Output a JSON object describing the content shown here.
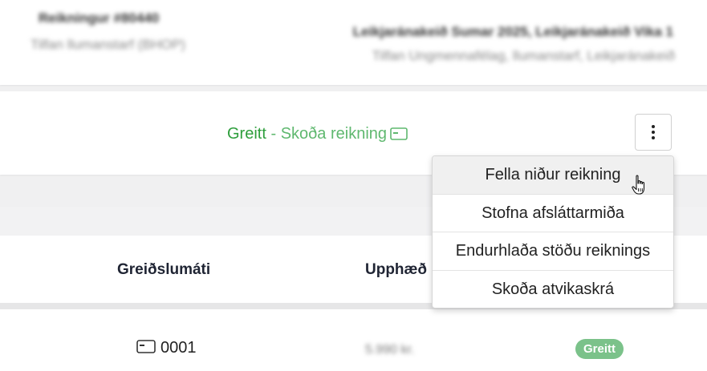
{
  "invoice": {
    "number": "Reikningur #80440",
    "subtitle": "Tilfan llumanstarf (BHOP)"
  },
  "event": {
    "title": "Leikjaránakeið Sumar 2025, Leikjaránakeið Vika 1",
    "subtitle": "Tilfan Ungmennafélag, llumanstarf, Leikjaránakeið"
  },
  "status": {
    "paid_label": "Greitt",
    "separator": "-",
    "view_invoice_label": "Skoða reikning",
    "paid_color": "#2e9e3c",
    "link_color": "#5fb86f"
  },
  "actions_menu": {
    "items": [
      "Fella niður reikning",
      "Stofna afsláttarmiða",
      "Endurhlaða stöðu reiknings",
      "Skoða atvikaskrá"
    ],
    "hovered_index": 0
  },
  "table": {
    "headers": [
      "Greiðslumáti",
      "Upphæð"
    ],
    "rows": [
      {
        "method": "0001",
        "amount": "5.990 kr.",
        "status": "Greitt"
      }
    ],
    "badge_color": "#7bc28a"
  },
  "icons": {
    "payment_card": "credit-card-icon",
    "menu": "kebab-menu-icon",
    "cursor": "hand-pointer-cursor"
  }
}
